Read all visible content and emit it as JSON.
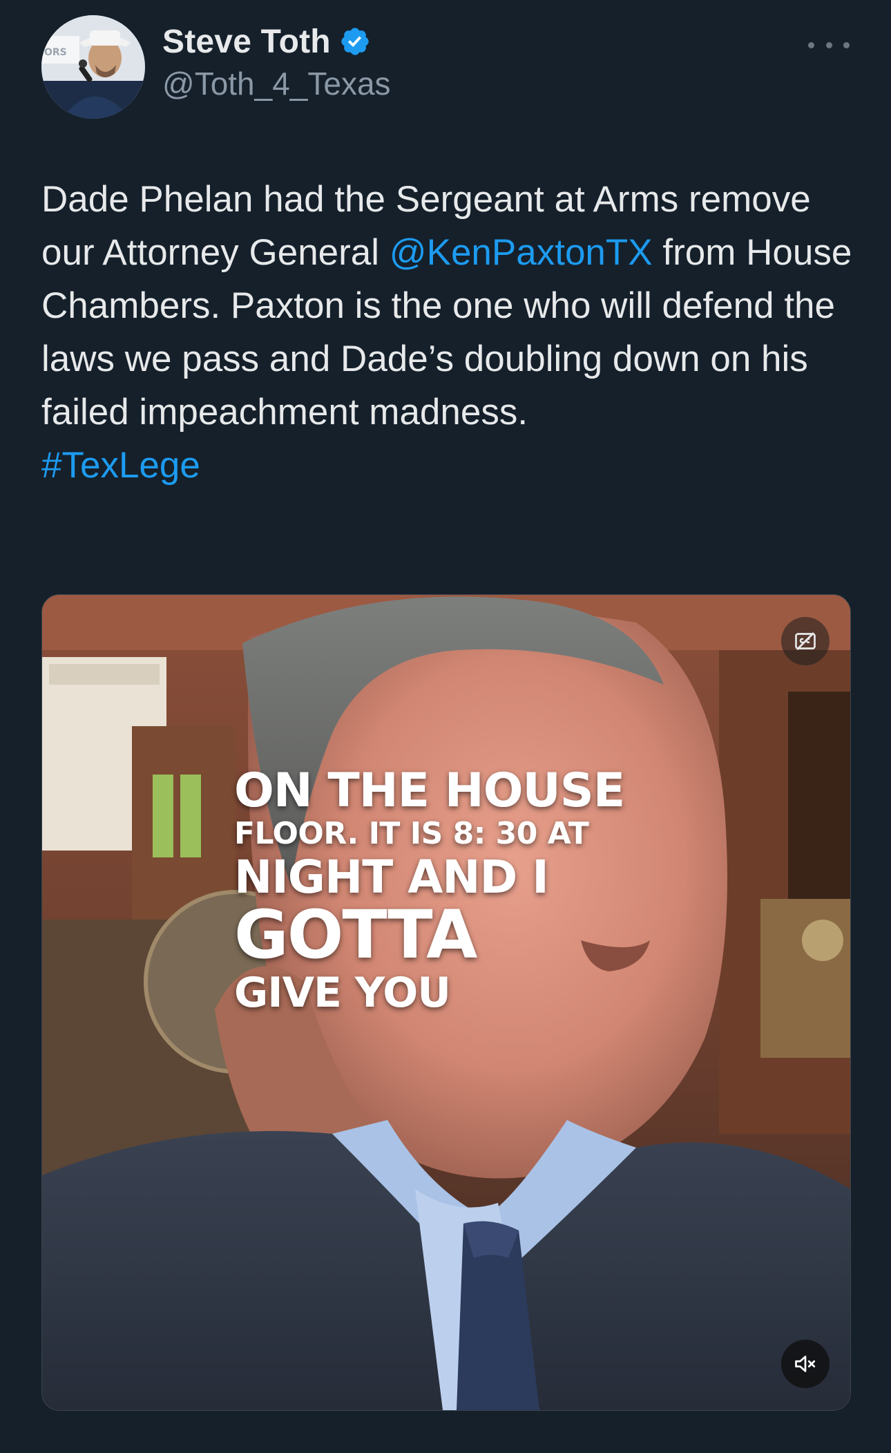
{
  "user": {
    "display_name": "Steve Toth",
    "handle": "@Toth_4_Texas",
    "verified": true,
    "avatar_icon": "profile-avatar",
    "verified_icon": "verified-badge-icon"
  },
  "tweet": {
    "text_before_mention": "Dade Phelan had the Sergeant at Arms remove our Attorney General ",
    "mention": "@KenPaxtonTX",
    "text_after_mention": " from House Chambers. Paxton is the one who will defend the laws we pass and Dade’s doubling down on his failed impeachment madness.",
    "hashtag": "#TexLege"
  },
  "media": {
    "type": "video",
    "caption_lines": [
      "ON THE HOUSE",
      "FLOOR. IT IS 8: 30 AT",
      "NIGHT AND I",
      "GOTTA",
      "GIVE YOU"
    ],
    "captions_icon": "closed-captions-off-icon",
    "mute_icon": "speaker-muted-icon",
    "muted": true
  },
  "menu": {
    "more_icon": "more-options-icon"
  },
  "colors": {
    "background": "#15202b",
    "text": "#e7e9ea",
    "secondary": "#8b98a5",
    "link": "#1d9bf0"
  }
}
